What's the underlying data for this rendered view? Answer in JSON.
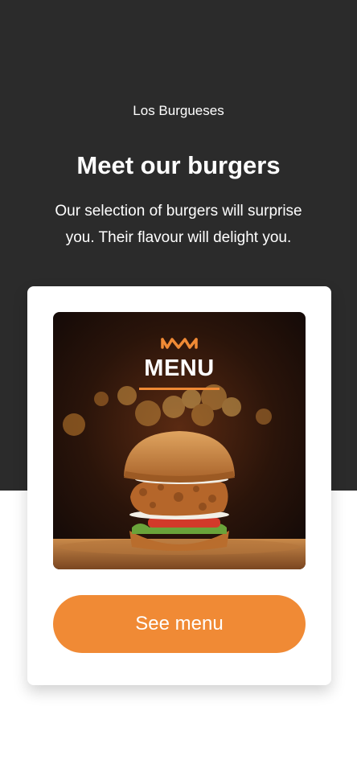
{
  "header": {
    "brand": "Los Burgueses",
    "title": "Meet our burgers",
    "subtitle": "Our selection of burgers will surprise you. Their flavour will delight you."
  },
  "card": {
    "image": {
      "overlay_title": "MENU",
      "logo_icon": "crown-icon",
      "subject": "burger-photo"
    },
    "button_label": "See menu"
  },
  "colors": {
    "hero_background": "#2b2b2b",
    "accent": "#f08a35",
    "card_background": "#ffffff",
    "page_background": "#ffffff"
  }
}
